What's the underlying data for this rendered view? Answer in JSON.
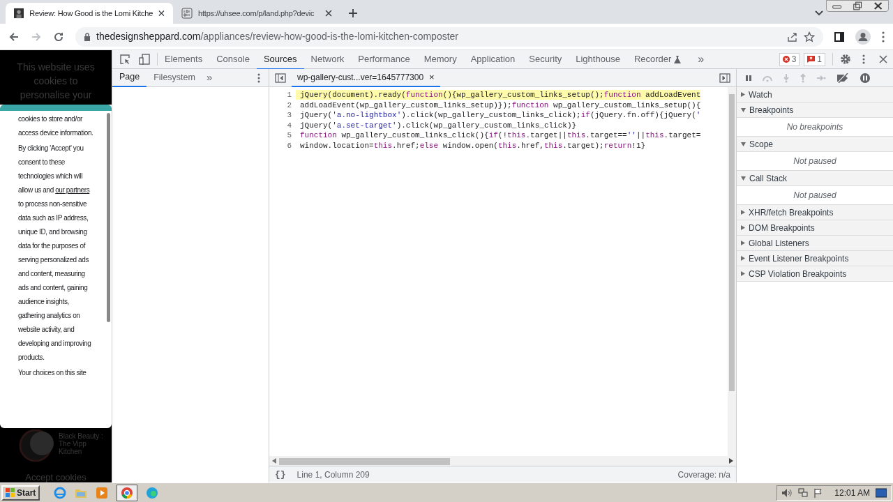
{
  "browser_tabs": [
    {
      "title": "Review: How Good is the Lomi Kitche",
      "selected": true
    },
    {
      "title": "https://uhsee.com/p/land.php?devic",
      "selected": false
    }
  ],
  "address": {
    "domain": "thedesignsheppard.com",
    "path": "/appliances/review-how-good-is-the-lomi-kitchen-composter"
  },
  "page": {
    "background_heading": "This website uses cookies to personalise your",
    "related_title": "Black Beauty : The Vipp Kitchen",
    "accept_text": "Accept cookies",
    "cookie_paragraphs": [
      {
        "before": "cookies to store and/or access device information."
      },
      {
        "before": "By clicking 'Accept' you consent to these technologies which will allow us and",
        "link": "our partners",
        "after": "to process non-sensitive data such as IP address, unique ID, and browsing data for the purposes of serving personalized ads and content, measuring ads and content, gaining audience insights, gathering analytics on website activity, and developing and improving products."
      },
      {
        "before": "Your choices on this site"
      }
    ]
  },
  "devtools": {
    "tabs": [
      {
        "label": "Elements",
        "selected": false
      },
      {
        "label": "Console",
        "selected": false
      },
      {
        "label": "Sources",
        "selected": true
      },
      {
        "label": "Network",
        "selected": false
      },
      {
        "label": "Performance",
        "selected": false
      },
      {
        "label": "Memory",
        "selected": false
      },
      {
        "label": "Application",
        "selected": false
      },
      {
        "label": "Security",
        "selected": false
      },
      {
        "label": "Lighthouse",
        "selected": false
      },
      {
        "label": "Recorder",
        "selected": false
      }
    ],
    "more": "»",
    "error_count": "3",
    "issue_count": "1",
    "navigator_tabs": [
      {
        "label": "Page",
        "selected": true
      },
      {
        "label": "Filesystem",
        "selected": false
      }
    ],
    "file_tab": {
      "label": "wp-gallery-cust...ver=1645777300",
      "close": "×"
    },
    "code_lines": [
      {
        "number": "1",
        "highlighted": true,
        "tokens": [
          {
            "kind": "plain",
            "text": "jQuery(document).ready("
          },
          {
            "kind": "keyword",
            "text": "function"
          },
          {
            "kind": "plain",
            "text": "(){wp_gallery_custom_links_setup();"
          },
          {
            "kind": "keyword",
            "text": "function"
          },
          {
            "kind": "plain",
            "text": " addLoadEvent"
          }
        ]
      },
      {
        "number": "2",
        "highlighted": false,
        "tokens": [
          {
            "kind": "plain",
            "text": "addLoadEvent(wp_gallery_custom_links_setup)});"
          },
          {
            "kind": "keyword",
            "text": "function"
          },
          {
            "kind": "plain",
            "text": " wp_gallery_custom_links_setup(){"
          }
        ]
      },
      {
        "number": "3",
        "highlighted": false,
        "tokens": [
          {
            "kind": "plain",
            "text": "jQuery("
          },
          {
            "kind": "string",
            "text": "'a.no-lightbox'"
          },
          {
            "kind": "plain",
            "text": ").click(wp_gallery_custom_links_click);"
          },
          {
            "kind": "keyword",
            "text": "if"
          },
          {
            "kind": "plain",
            "text": "(jQuery.fn.off){jQuery("
          },
          {
            "kind": "string",
            "text": "'"
          }
        ]
      },
      {
        "number": "4",
        "highlighted": false,
        "tokens": [
          {
            "kind": "plain",
            "text": "jQuery("
          },
          {
            "kind": "string",
            "text": "'a.set-target'"
          },
          {
            "kind": "plain",
            "text": ").click(wp_gallery_custom_links_click)}"
          }
        ]
      },
      {
        "number": "5",
        "highlighted": false,
        "tokens": [
          {
            "kind": "keyword",
            "text": "function"
          },
          {
            "kind": "plain",
            "text": " wp_gallery_custom_links_click(){"
          },
          {
            "kind": "keyword",
            "text": "if"
          },
          {
            "kind": "plain",
            "text": "(!"
          },
          {
            "kind": "keyword",
            "text": "this"
          },
          {
            "kind": "plain",
            "text": ".target||"
          },
          {
            "kind": "keyword",
            "text": "this"
          },
          {
            "kind": "plain",
            "text": ".target=="
          },
          {
            "kind": "string",
            "text": "''"
          },
          {
            "kind": "plain",
            "text": "||"
          },
          {
            "kind": "keyword",
            "text": "this"
          },
          {
            "kind": "plain",
            "text": ".target="
          }
        ]
      },
      {
        "number": "6",
        "highlighted": false,
        "tokens": [
          {
            "kind": "plain",
            "text": "window.location="
          },
          {
            "kind": "keyword",
            "text": "this"
          },
          {
            "kind": "plain",
            "text": ".href;"
          },
          {
            "kind": "keyword",
            "text": "else"
          },
          {
            "kind": "plain",
            "text": " window.open("
          },
          {
            "kind": "keyword",
            "text": "this"
          },
          {
            "kind": "plain",
            "text": ".href,"
          },
          {
            "kind": "keyword",
            "text": "this"
          },
          {
            "kind": "plain",
            "text": ".target);"
          },
          {
            "kind": "keyword",
            "text": "return"
          },
          {
            "kind": "plain",
            "text": "!1}"
          }
        ]
      }
    ],
    "status": {
      "format": "{}",
      "position": "Line 1, Column 209",
      "coverage": "Coverage: n/a"
    },
    "debugger_sections": [
      {
        "title": "Watch",
        "expanded": false
      },
      {
        "title": "Breakpoints",
        "expanded": true,
        "message": "No breakpoints"
      },
      {
        "title": "Scope",
        "expanded": true,
        "message": "Not paused"
      },
      {
        "title": "Call Stack",
        "expanded": true,
        "message": "Not paused"
      },
      {
        "title": "XHR/fetch Breakpoints",
        "expanded": false
      },
      {
        "title": "DOM Breakpoints",
        "expanded": false
      },
      {
        "title": "Global Listeners",
        "expanded": false
      },
      {
        "title": "Event Listener Breakpoints",
        "expanded": false
      },
      {
        "title": "CSP Violation Breakpoints",
        "expanded": false
      }
    ]
  },
  "taskbar": {
    "start": "Start",
    "clock": "12:01 AM"
  }
}
